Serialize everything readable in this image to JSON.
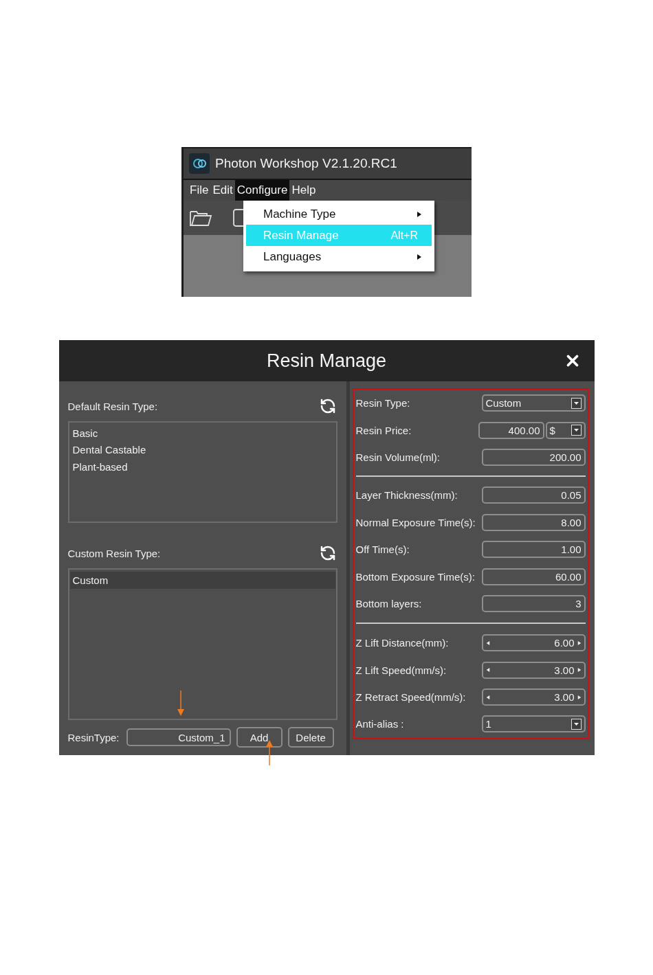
{
  "app_window": {
    "title": "Photon Workshop V2.1.20.RC1",
    "menu_bar": [
      {
        "label": "File",
        "selected": false
      },
      {
        "label": "Edit",
        "selected": false
      },
      {
        "label": "Configure",
        "selected": true
      },
      {
        "label": "Help",
        "selected": false
      }
    ],
    "menu": [
      {
        "label": "Machine Type",
        "submenu": true,
        "selected": false
      },
      {
        "label": "Resin Manage",
        "shortcut": "Alt+R",
        "submenu": false,
        "selected": true
      },
      {
        "label": "Languages",
        "submenu": true,
        "selected": false
      }
    ]
  },
  "dialog": {
    "title": "Resin Manage",
    "default_resin": {
      "label": "Default Resin Type:",
      "items": [
        {
          "label": "Basic",
          "selected": false
        },
        {
          "label": "Dental Castable",
          "selected": false
        },
        {
          "label": "Plant-based",
          "selected": false
        }
      ]
    },
    "custom_resin": {
      "label": "Custom Resin Type:",
      "items": [
        {
          "label": "Custom",
          "selected": true
        }
      ]
    },
    "new_resin": {
      "label": "ResinType:",
      "value": "Custom_1"
    },
    "buttons": [
      "Add",
      "Delete"
    ],
    "settings": [
      {
        "rows": [
          {
            "kind": "select",
            "label": "Resin Type:",
            "value": "Custom"
          },
          {
            "kind": "price",
            "label": "Resin Price:",
            "value": "400.00",
            "currency": "$"
          },
          {
            "kind": "number",
            "label": "Resin Volume(ml):",
            "value": "200.00"
          }
        ]
      },
      {
        "rows": [
          {
            "kind": "number",
            "label": "Layer Thickness(mm):",
            "value": "0.05"
          },
          {
            "kind": "number",
            "label": "Normal Exposure Time(s):",
            "value": "8.00"
          },
          {
            "kind": "number",
            "label": "Off Time(s):",
            "value": "1.00"
          },
          {
            "kind": "number",
            "label": "Bottom Exposure Time(s):",
            "value": "60.00"
          },
          {
            "kind": "number",
            "label": "Bottom layers:",
            "value": "3"
          }
        ]
      },
      {
        "rows": [
          {
            "kind": "spinner",
            "label": "Z Lift Distance(mm):",
            "value": "6.00"
          },
          {
            "kind": "spinner",
            "label": "Z Lift Speed(mm/s):",
            "value": "3.00"
          },
          {
            "kind": "spinner",
            "label": "Z Retract Speed(mm/s):",
            "value": "3.00"
          },
          {
            "kind": "select",
            "label": "Anti-alias :",
            "value": "1"
          }
        ]
      }
    ]
  }
}
